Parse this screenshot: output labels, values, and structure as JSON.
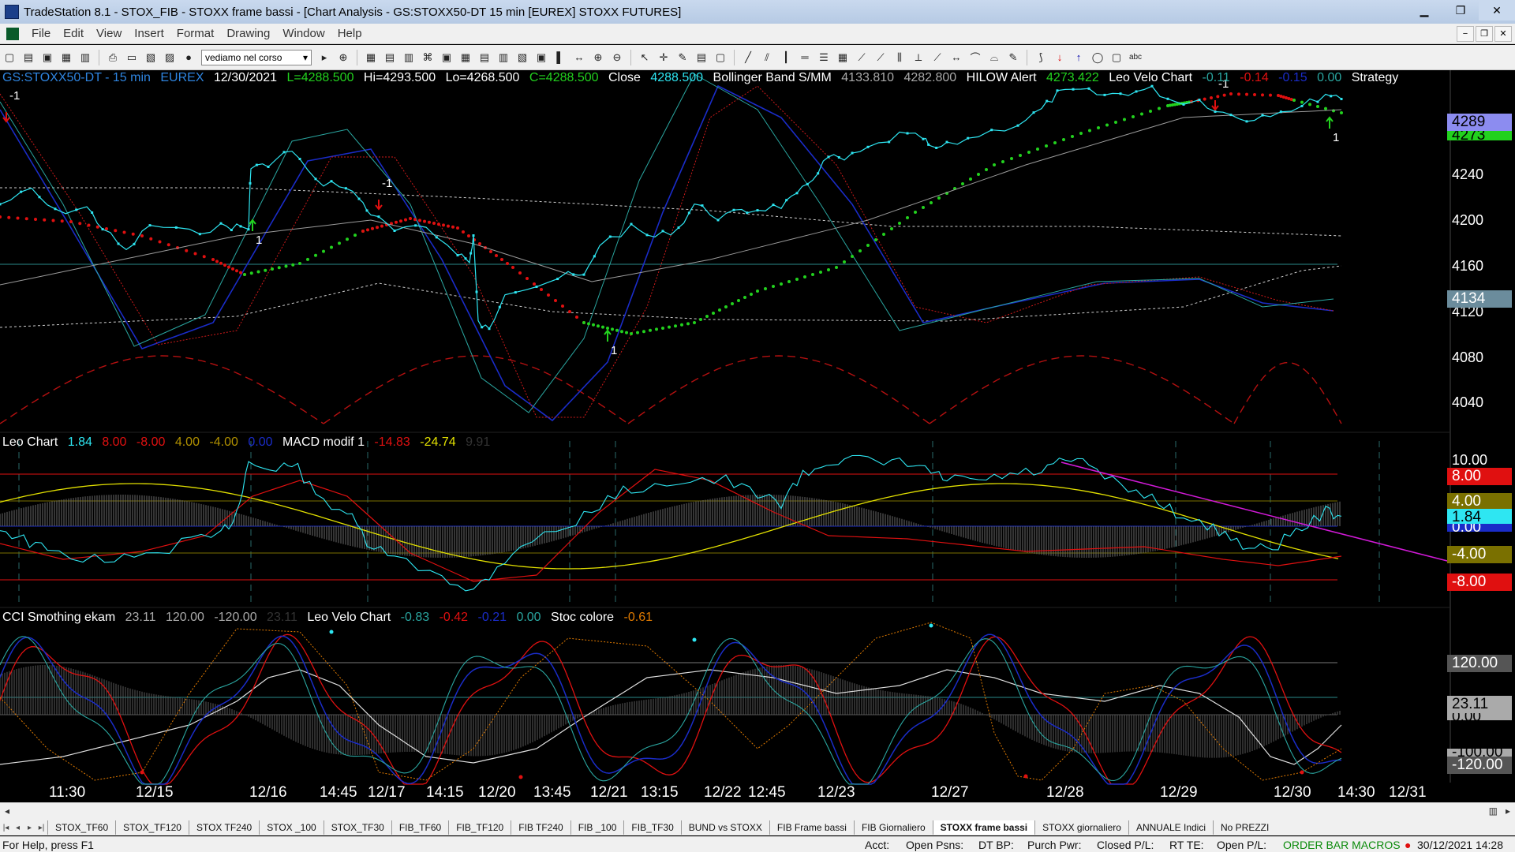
{
  "window": {
    "title": "TradeStation 8.1 - STOX_FIB - STOXX frame bassi - [Chart Analysis - GS:STOXX50-DT  15 min  [EUREX] STOXX FUTURES]",
    "min": "▁",
    "max": "❐",
    "close": "✕"
  },
  "menu": {
    "items": [
      "File",
      "Edit",
      "View",
      "Insert",
      "Format",
      "Drawing",
      "Window",
      "Help"
    ],
    "mdi": [
      "−",
      "❐",
      "✕"
    ]
  },
  "toolbar": {
    "interval_select": "vediamo nel corso"
  },
  "price_pane": {
    "symbol": "GS:STOXX50-DT - 15 min",
    "exchange": "EUREX",
    "date": "12/30/2021",
    "last": "L=4288.500",
    "high": "Hi=4293.500",
    "low": "Lo=4268.500",
    "close_val": "C=4288.500",
    "close_label": "Close",
    "close_num": "4288.500",
    "bb_label": "Bollinger Band S/MM",
    "bb_v1": "4133.810",
    "bb_v2": "4282.800",
    "hilow_label": "HILOW Alert",
    "hilow_v": "4273.422",
    "velo_label": "Leo Velo Chart",
    "velo_v1": "-0.11",
    "velo_v2": "-0.14",
    "velo_v3": "-0.15",
    "velo_v4": "0.00",
    "strategy": "Strategy",
    "axis": [
      "4240",
      "4200",
      "4160",
      "4120",
      "4080",
      "4040"
    ],
    "price_tag": "4289",
    "price_tag2": "4273",
    "bb_tag": "4134",
    "signals": [
      "-1",
      "1",
      "-1",
      "1",
      "-1",
      "1"
    ]
  },
  "macd_pane": {
    "label": "Leo Chart",
    "v1": "1.84",
    "v2": "8.00",
    "v3": "-8.00",
    "v4": "4.00",
    "v5": "-4.00",
    "v6": "0.00",
    "macd_label": "MACD modif 1",
    "macd_v1": "-14.83",
    "macd_v2": "-24.74",
    "macd_v3": "9.91",
    "axis_top": "10.00",
    "tags": [
      "8.00",
      "4.00",
      "1.84",
      "0.00",
      "-4.00",
      "-8.00"
    ]
  },
  "cci_pane": {
    "label": "CCI Smothing ekam",
    "v1": "23.11",
    "v2": "120.00",
    "v3": "-120.00",
    "v4": "23.11",
    "velo_label": "Leo Velo Chart",
    "velo_v1": "-0.83",
    "velo_v2": "-0.42",
    "velo_v3": "-0.21",
    "velo_v4": "0.00",
    "stoc_label": "Stoc colore",
    "stoc_v": "-0.61",
    "tags": [
      "120.00",
      "23.11",
      "0.00",
      "-100.00",
      "-120.00"
    ]
  },
  "xaxis": [
    "11:30",
    "12/15",
    "12/16",
    "14:45",
    "12/17",
    "14:15",
    "12/20",
    "13:45",
    "12/21",
    "13:15",
    "12/22",
    "12:45",
    "12/23",
    "12/27",
    "12/28",
    "12/29",
    "12/30",
    "14:30",
    "12/31"
  ],
  "tabs": [
    "STOX_TF60",
    "STOX_TF120",
    "STOX TF240",
    "STOX _100",
    "STOX_TF30",
    "FIB_TF60",
    "FIB_TF120",
    "FIB TF240",
    "FIB _100",
    "FIB_TF30",
    "BUND vs STOXX",
    "FIB Frame bassi",
    "FIB Giornaliero",
    "STOXX frame bassi",
    "STOXX giornaliero",
    "ANNUALE Indici",
    "No PREZZI"
  ],
  "active_tab": "STOXX frame bassi",
  "status": {
    "help": "For Help, press F1",
    "acct": "Acct:",
    "open_psns": "Open Psns:",
    "dt_bp": "DT BP:",
    "purch_pwr": "Purch Pwr:",
    "closed_pl": "Closed P/L:",
    "rt_te": "RT TE:",
    "open_pl": "Open P/L:",
    "macros": "ORDER BAR  MACROS",
    "datetime": "30/12/2021 14:28"
  },
  "colors": {
    "price": "#2ee6f2",
    "green": "#22d11e",
    "red": "#e01010",
    "blue": "#1a2cc8",
    "teal": "#2aa6a0",
    "yellow": "#e2e000",
    "magenta": "#d21ad8",
    "gray": "#8a8a8a"
  }
}
